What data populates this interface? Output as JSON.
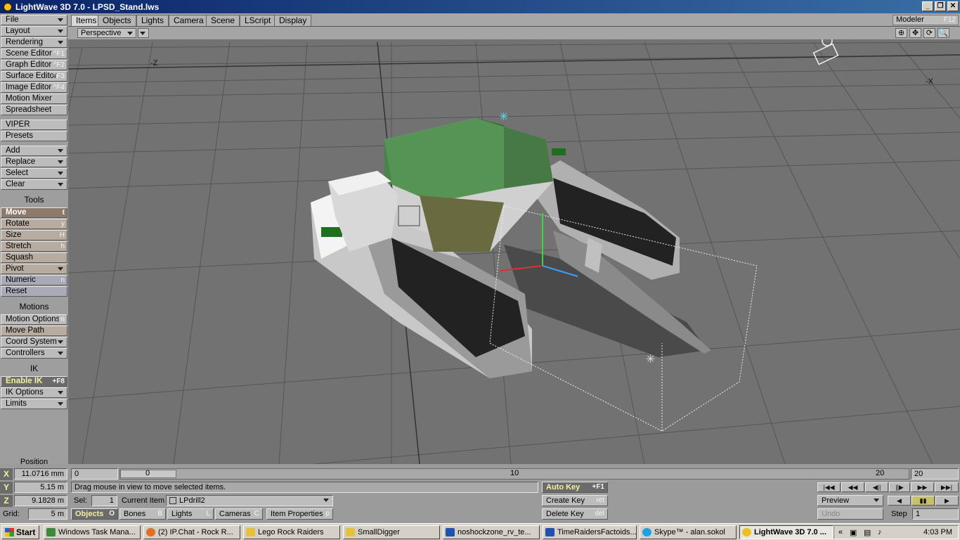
{
  "window": {
    "title": "LightWave 3D 7.0 - LPSD_Stand.lws",
    "controls": [
      "_",
      "❐",
      "✕"
    ]
  },
  "tabs": [
    "Items",
    "Objects",
    "Lights",
    "Camera",
    "Scene",
    "LScript",
    "Display"
  ],
  "modeler": {
    "label": "Modeler",
    "shortcut": "F12"
  },
  "left_panel": {
    "file": "File",
    "layout": "Layout",
    "rendering": "Rendering",
    "scene_editor": "Scene Editor",
    "scene_editor_sc": "^F1",
    "graph_editor": "Graph Editor",
    "graph_editor_sc": "^F2",
    "surface_editor": "Surface Editor",
    "surface_editor_sc": "^F3",
    "image_editor": "Image Editor",
    "image_editor_sc": "^F4",
    "motion_mixer": "Motion Mixer",
    "spreadsheet": "Spreadsheet",
    "viper": "VIPER",
    "presets": "Presets",
    "add": "Add",
    "replace": "Replace",
    "select": "Select",
    "clear": "Clear",
    "tools_header": "Tools",
    "move": "Move",
    "move_sc": "t",
    "rotate": "Rotate",
    "rotate_sc": "y",
    "size": "Size",
    "size_sc": "H",
    "stretch": "Stretch",
    "stretch_sc": "h",
    "squash": "Squash",
    "pivot": "Pivot",
    "numeric": "Numeric",
    "numeric_sc": "n",
    "reset": "Reset",
    "motions_header": "Motions",
    "motion_options": "Motion Options",
    "motion_options_sc": "m",
    "move_path": "Move Path",
    "coord_system": "Coord System",
    "controllers": "Controllers",
    "ik_header": "IK",
    "enable_ik": "Enable IK",
    "enable_ik_sc": "+F8",
    "ik_options": "IK Options",
    "limits": "Limits",
    "position_label": "Position"
  },
  "viewport": {
    "view_mode": "Perspective",
    "axis_z": "-Z",
    "axis_x": "-X",
    "icons": [
      "⊕",
      "✥",
      "⟳",
      "🔍"
    ]
  },
  "bottom": {
    "x_label": "X",
    "x_value": "11.0716 mm",
    "y_label": "Y",
    "y_value": "5.15 m",
    "z_label": "Z",
    "z_value": "9.1828 m",
    "grid_label": "Grid:",
    "grid_value": "5 m",
    "frame_start": "0",
    "frame_end": "20",
    "tick_0": "0",
    "tick_10": "10",
    "tick_20": "20",
    "status": "Drag mouse in view to move selected items.",
    "sel_label": "Sel:",
    "sel_value": "1",
    "current_item_label": "Current Item",
    "current_item": "LPdrill2",
    "objects": "Objects",
    "objects_sc": "O",
    "bones": "Bones",
    "bones_sc": "B",
    "lights": "Lights",
    "lights_sc": "L",
    "cameras": "Cameras",
    "cameras_sc": "C",
    "item_properties": "Item Properties",
    "item_properties_sc": "p",
    "auto_key": "Auto Key",
    "auto_key_sc": "+F1",
    "create_key": "Create Key",
    "create_key_sc": "ret",
    "delete_key": "Delete Key",
    "delete_key_sc": "del",
    "preview": "Preview",
    "undo": "Undo",
    "step_label": "Step",
    "step_value": "1"
  },
  "taskbar": {
    "start": "Start",
    "tasks": [
      "Windows Task Mana...",
      "(2) IP.Chat - Rock R...",
      "Lego Rock Raiders",
      "SmallDigger",
      "noshockzone_rv_te...",
      "TimeRaidersFactoids...",
      "Skype™ - alan.sokol",
      "LightWave 3D 7.0 ..."
    ],
    "clock": "4:03 PM"
  },
  "colors": {
    "title_bar": "#0a246a",
    "viewport_bg": "#727272",
    "model_green": "#3f8a3f",
    "accent_yellow": "#f4f0a0"
  }
}
